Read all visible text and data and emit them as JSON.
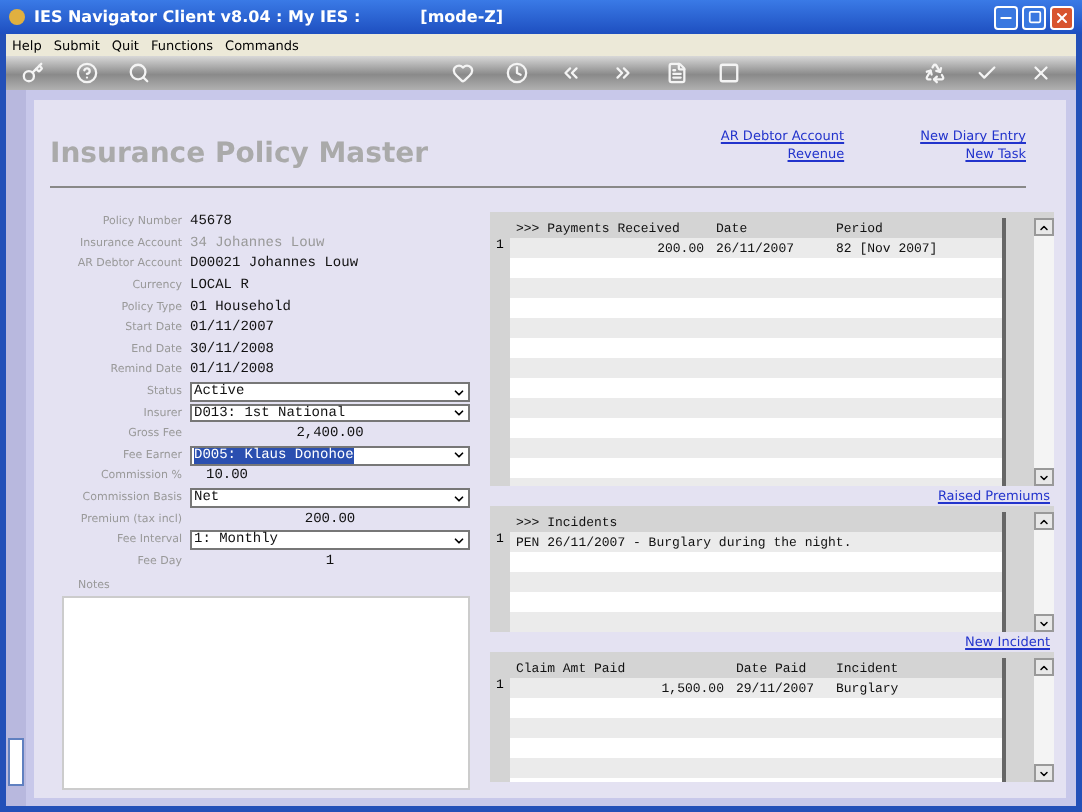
{
  "window": {
    "title": "IES Navigator Client v8.04 : My IES :",
    "mode": "[mode-Z]"
  },
  "menu": [
    "Help",
    "Submit",
    "Quit",
    "Functions",
    "Commands"
  ],
  "page": {
    "title": "Insurance Policy Master",
    "link_columns": [
      [
        "AR Debtor Account",
        "Revenue"
      ],
      [
        "New Diary Entry",
        "New Task"
      ]
    ]
  },
  "fields": [
    {
      "label": "Policy Number",
      "value": "45678",
      "kind": "text",
      "disabled": false,
      "highlighted": false
    },
    {
      "label": "Insurance Account",
      "value": "34 Johannes Louw",
      "kind": "text",
      "disabled": true,
      "highlighted": false
    },
    {
      "label": "AR Debtor Account",
      "value": "D00021 Johannes Louw",
      "kind": "text",
      "disabled": false,
      "highlighted": false
    },
    {
      "label": "Currency",
      "value": "LOCAL R",
      "kind": "text",
      "disabled": false,
      "highlighted": false
    },
    {
      "label": "Policy Type",
      "value": "01 Household",
      "kind": "text",
      "disabled": false,
      "highlighted": false
    },
    {
      "label": "Start Date",
      "value": "01/11/2007",
      "kind": "text",
      "disabled": false,
      "highlighted": false
    },
    {
      "label": "End Date",
      "value": "30/11/2008",
      "kind": "text",
      "disabled": false,
      "highlighted": false
    },
    {
      "label": "Remind Date",
      "value": "01/11/2008",
      "kind": "text",
      "disabled": false,
      "highlighted": false
    },
    {
      "label": "Status",
      "value": "Active",
      "kind": "select",
      "disabled": false,
      "highlighted": false
    },
    {
      "label": "Insurer",
      "value": "D013: 1st National",
      "kind": "select",
      "disabled": false,
      "highlighted": false
    },
    {
      "label": "Gross Fee",
      "value": "2,400.00",
      "kind": "amount",
      "disabled": false,
      "highlighted": false
    },
    {
      "label": "Fee Earner",
      "value": "D005: Klaus Donohoe",
      "kind": "select",
      "disabled": false,
      "highlighted": true
    },
    {
      "label": "Commission %",
      "value": "10.00",
      "kind": "short",
      "disabled": false,
      "highlighted": false
    },
    {
      "label": "Commission Basis",
      "value": "Net",
      "kind": "select",
      "disabled": false,
      "highlighted": false
    },
    {
      "label": "Premium (tax incl)",
      "value": "200.00",
      "kind": "amount",
      "disabled": false,
      "highlighted": false
    },
    {
      "label": "Fee Interval",
      "value": "1: Monthly",
      "kind": "select",
      "disabled": false,
      "highlighted": false
    },
    {
      "label": "Fee Day",
      "value": "1",
      "kind": "amount",
      "disabled": false,
      "highlighted": false
    }
  ],
  "notes": {
    "label": "Notes"
  },
  "grids": [
    {
      "columns": [
        ">>> Payments Received",
        "Date",
        "Period"
      ],
      "rows": [
        {
          "number": "1",
          "cells": [
            "200.00",
            "26/11/2007",
            "82  [Nov 2007]"
          ]
        }
      ],
      "link": "Raised Premiums"
    },
    {
      "columns": [
        ">>> Incidents"
      ],
      "rows": [
        {
          "number": "1",
          "cells": [
            "PEN 26/11/2007 - Burglary during the night."
          ]
        }
      ],
      "link": "New Incident"
    },
    {
      "columns": [
        "Claim Amt Paid",
        "Date Paid",
        "Incident"
      ],
      "rows": [
        {
          "number": "1",
          "cells": [
            "1,500.00",
            "29/11/2007",
            "Burglary"
          ]
        }
      ]
    }
  ]
}
